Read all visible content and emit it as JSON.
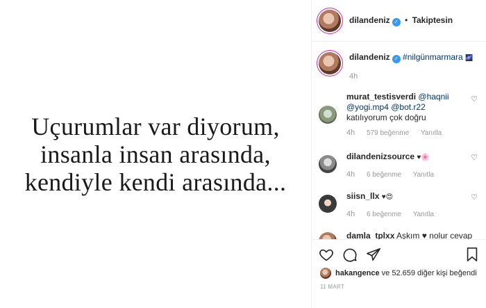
{
  "post": {
    "quote_lines": [
      "Uçurumlar var diyorum,",
      "insanla insan arasında,",
      "kendiyle kendi arasında..."
    ]
  },
  "header": {
    "username": "dilandeniz",
    "separator": "•",
    "follow_label": "Takiptesin"
  },
  "caption": {
    "username": "dilandeniz",
    "text": "#nilgünmarmara",
    "emoji": "🌌",
    "time": "4h"
  },
  "comments": [
    {
      "username": "murat_testisverdi",
      "text_parts": [
        "@haqnii",
        "@yogi.mp4",
        "@bot.r22",
        "katılıyorum çok doğru"
      ],
      "time": "4h",
      "likes": "579 beğenme",
      "reply": "Yanıtla"
    },
    {
      "username": "dilandenizsource",
      "text": "♥🌸",
      "time": "4h",
      "likes": "6 beğenme",
      "reply": "Yanıtla"
    },
    {
      "username": "siisn_llx",
      "text": "♥😍",
      "time": "4h",
      "likes": "6 beğenme",
      "reply": "Yanıtla"
    },
    {
      "username": "damla_tplxx",
      "text": "Aşkım ♥ nolur cevap"
    }
  ],
  "likes_line": {
    "liker": "hakangence",
    "rest": "ve 52.659 diğer kişi beğendi"
  },
  "date": "11 MART",
  "icons": [
    "heart-icon",
    "comment-icon",
    "share-icon",
    "bookmark-icon"
  ]
}
